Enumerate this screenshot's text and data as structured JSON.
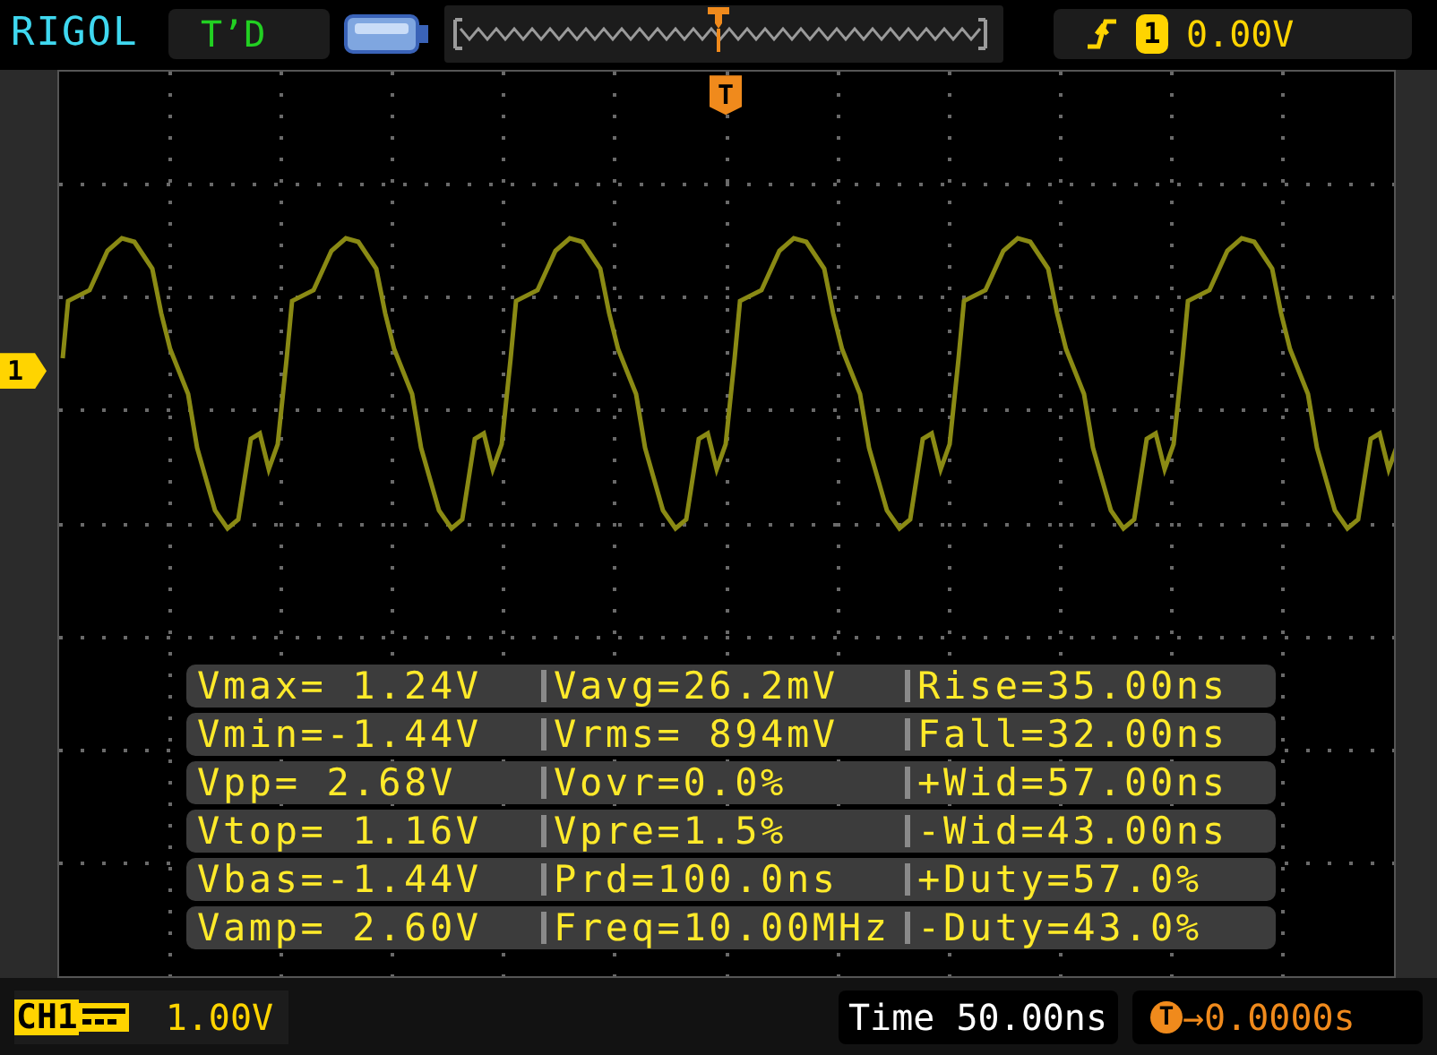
{
  "header": {
    "brand": "RIGOL",
    "run_status": "T’D",
    "trigger_channel": "1",
    "trigger_level": "0.00V"
  },
  "trigger_marker": "T",
  "channel_marker": "1",
  "measurements": [
    [
      "Vmax= 1.24V",
      "Vavg=26.2mV",
      "Rise=35.00ns"
    ],
    [
      "Vmin=-1.44V",
      "Vrms= 894mV",
      "Fall=32.00ns"
    ],
    [
      "Vpp= 2.68V",
      "Vovr=0.0%",
      "+Wid=57.00ns"
    ],
    [
      "Vtop= 1.16V",
      "Vpre=1.5%",
      "-Wid=43.00ns"
    ],
    [
      "Vbas=-1.44V",
      "Prd=100.0ns",
      "+Duty=57.0%"
    ],
    [
      "Vamp= 2.60V",
      "Freq=10.00MHz",
      "-Duty=43.0%"
    ]
  ],
  "footer": {
    "channel": "CH1",
    "scale": "1.00V",
    "timebase": "Time 50.00ns",
    "offset_marker": "T",
    "offset": "→0.0000s"
  }
}
